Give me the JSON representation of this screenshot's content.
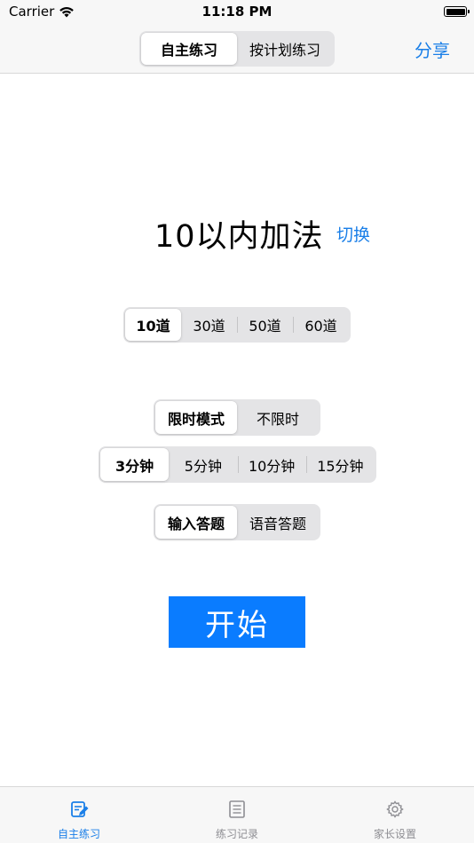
{
  "status_bar": {
    "carrier": "Carrier",
    "time": "11:18 PM"
  },
  "nav": {
    "segments": [
      "自主练习",
      "按计划练习"
    ],
    "selected_index": 0,
    "share_label": "分享"
  },
  "exercise": {
    "title": "10以内加法",
    "switch_label": "切换"
  },
  "question_count": {
    "options": [
      "10道",
      "30道",
      "50道",
      "60道"
    ],
    "selected_index": 0
  },
  "time_mode": {
    "options": [
      "限时模式",
      "不限时"
    ],
    "selected_index": 0
  },
  "duration": {
    "options": [
      "3分钟",
      "5分钟",
      "10分钟",
      "15分钟"
    ],
    "selected_index": 0
  },
  "answer_mode": {
    "options": [
      "输入答题",
      "语音答题"
    ],
    "selected_index": 0
  },
  "start_label": "开始",
  "tabs": [
    {
      "label": "自主练习",
      "icon": "practice-icon",
      "active": true
    },
    {
      "label": "练习记录",
      "icon": "record-list-icon",
      "active": false
    },
    {
      "label": "家长设置",
      "icon": "gear-icon",
      "active": false
    }
  ],
  "colors": {
    "accent": "#1a7fe8",
    "start_button": "#0a7cff",
    "inactive_tab": "#8e8e93"
  }
}
